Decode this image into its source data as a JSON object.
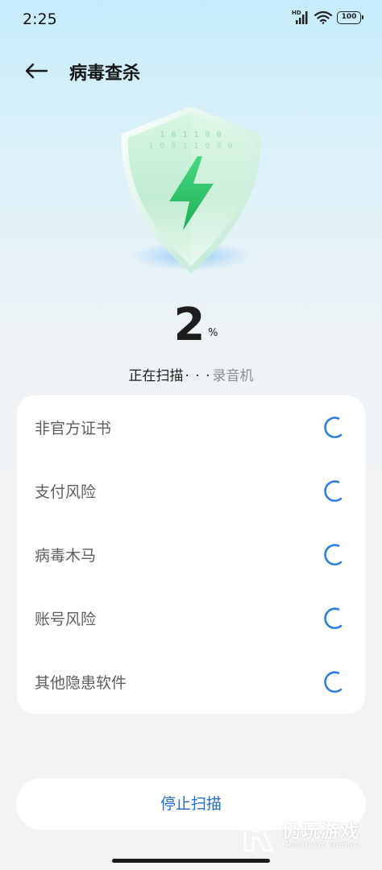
{
  "status_bar": {
    "time": "2:25",
    "hd_label": "HD",
    "battery": "100"
  },
  "header": {
    "title": "病毒查杀",
    "back_icon": "arrow-left-icon"
  },
  "shield": {
    "binary_row_1": "1 0 1 1 0 0",
    "binary_row_2": "1 0 0 1 1 0 0 0",
    "icon": "lightning-bolt-icon"
  },
  "progress": {
    "value": "2",
    "unit": "%"
  },
  "scan_status": {
    "prefix": "正在扫描",
    "dots": "· · ·",
    "target": "录音机"
  },
  "scan_items": [
    {
      "label": "非官方证书",
      "state": "scanning"
    },
    {
      "label": "支付风险",
      "state": "scanning"
    },
    {
      "label": "病毒木马",
      "state": "scanning"
    },
    {
      "label": "账号风险",
      "state": "scanning"
    },
    {
      "label": "其他隐患软件",
      "state": "scanning"
    }
  ],
  "stop_button": {
    "label": "停止扫描"
  },
  "watermark": {
    "title": "仍玩游戏",
    "subtitle": "Rengwan Games"
  },
  "colors": {
    "accent": "#1d6fd6",
    "spinner": "#2b7fe0",
    "bolt": "#2fc76a"
  }
}
